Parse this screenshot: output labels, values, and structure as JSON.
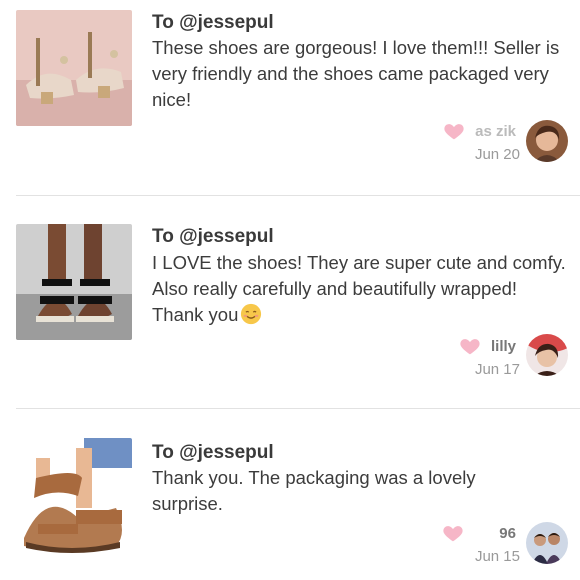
{
  "reviews": [
    {
      "to": "To @jessepul",
      "text": "These shoes are gorgeous! I love them!!! Seller is very friendly and the shoes came packaged very nice!",
      "user": "as        zik",
      "date": "Jun 20",
      "image": "pink-heeled-sandals",
      "emoji": ""
    },
    {
      "to": "To @jessepul",
      "text": "I LOVE the shoes! They are super cute and comfy. Also really carefully and beautifully wrapped! Thank you",
      "user": "lilly",
      "date": "Jun 17",
      "image": "black-strap-sandals",
      "emoji": "smiling-face-emoji"
    },
    {
      "to": "To @jessepul",
      "text": "Thank you. The packaging was a lovely surprise.",
      "user": "      96",
      "date": "Jun 15",
      "image": "tan-strap-sandals",
      "emoji": ""
    }
  ],
  "colors": {
    "heart": "#f6a9be",
    "divider": "#e2e2e2",
    "date": "#9a9a9a"
  }
}
